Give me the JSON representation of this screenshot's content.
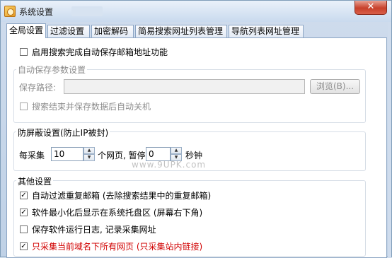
{
  "window": {
    "title": "系统设置",
    "close_label": "✕"
  },
  "tabs": [
    {
      "label": "全局设置",
      "active": true
    },
    {
      "label": "过滤设置",
      "active": false
    },
    {
      "label": "加密解码",
      "active": false
    },
    {
      "label": "简易搜索网址列表管理",
      "active": false
    },
    {
      "label": "导航列表网址管理",
      "active": false
    }
  ],
  "auto_save": {
    "enable_label": "启用搜索完成自动保存邮箱地址功能",
    "enable_checked": false,
    "group_title": "自动保存参数设置",
    "path_label": "保存路径:",
    "path_value": "",
    "browse_label": "浏览(B)...",
    "shutdown_label": "搜索结束并保存数据后自动关机",
    "shutdown_checked": false
  },
  "anti_block": {
    "group_title": "防屏蔽设置(防止IP被封)",
    "every_label": "每采集",
    "pages_value": "10",
    "pages_unit": "个网页, 暂停",
    "pause_value": "0",
    "seconds_unit": "秒钟"
  },
  "other": {
    "group_title": "其他设置",
    "options": [
      {
        "label": "自动过滤重复邮箱 (去除搜索结果中的重复邮箱)",
        "checked": true,
        "red": false
      },
      {
        "label": "软件最小化后显示在系统托盘区 (屏幕右下角)",
        "checked": true,
        "red": false
      },
      {
        "label": "保存软件运行日志, 记录采集网址",
        "checked": false,
        "red": false
      },
      {
        "label": "只采集当前域名下所有网页 (只采集站内链接)",
        "checked": true,
        "red": true
      }
    ]
  },
  "watermark": "www.9UPK.com",
  "colors": {
    "accent_red": "#d10000",
    "panel_bg": "#ffffff",
    "chrome_blue": "#c9daee"
  }
}
